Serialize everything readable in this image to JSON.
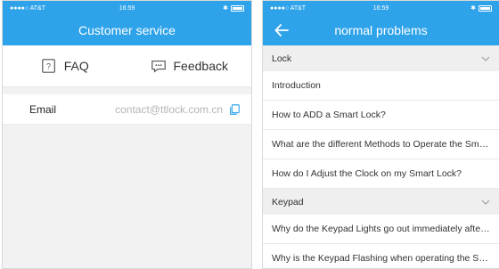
{
  "left": {
    "status": {
      "carrier": "●●●●○ AT&T",
      "time": "16:59"
    },
    "title": "Customer service",
    "options": [
      {
        "label": "FAQ",
        "icon": "faq-icon"
      },
      {
        "label": "Feedback",
        "icon": "feedback-icon"
      }
    ],
    "email": {
      "label": "Email",
      "value": "contact@ttlock.com.cn",
      "icon": "copy-icon"
    }
  },
  "right": {
    "status": {
      "carrier": "●●●●○ AT&T",
      "time": "16:59"
    },
    "title": "normal problems",
    "sections": [
      {
        "title": "Lock",
        "items": [
          "Introduction",
          "How to ADD a Smart Lock?",
          "What are the different Methods to Operate the Sma...",
          "How do I Adjust the Clock on my Smart Lock?"
        ]
      },
      {
        "title": "Keypad",
        "items": [
          "Why do the Keypad Lights go out immediately after...",
          "Why is the Keypad Flashing when operating the Sm..."
        ]
      }
    ]
  },
  "colors": {
    "accent": "#2ea3ea",
    "background": "#f2f2f2"
  }
}
